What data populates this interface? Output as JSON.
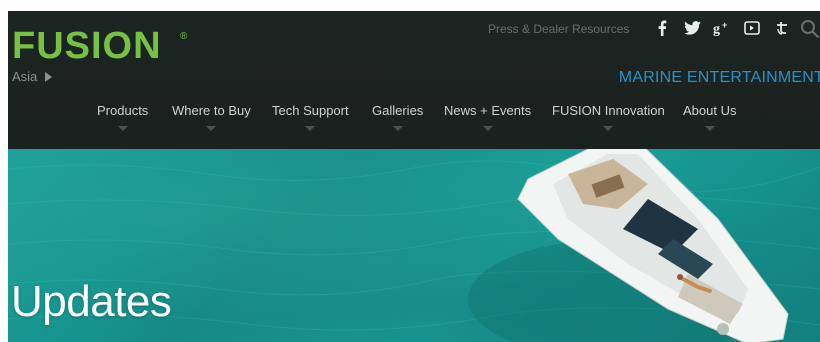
{
  "brand": {
    "name": "FUSION",
    "registered": "®",
    "color": "#76c043"
  },
  "header": {
    "region": "Asia",
    "press_link": "Press & Dealer Resources",
    "tagline": "MARINE ENTERTAINMENT",
    "social_icons": [
      "facebook-icon",
      "twitter-icon",
      "google-plus-icon",
      "youtube-icon",
      "tumblr-icon"
    ]
  },
  "nav": {
    "items": [
      {
        "label": "Products"
      },
      {
        "label": "Where to Buy"
      },
      {
        "label": "Tech Support"
      },
      {
        "label": "Galleries"
      },
      {
        "label": "News + Events"
      },
      {
        "label": "FUSION Innovation"
      },
      {
        "label": "About Us"
      }
    ]
  },
  "hero": {
    "title": "Updates"
  },
  "colors": {
    "header_bg": "#1d2522",
    "accent_blue": "#2d8fc7",
    "nav_text": "#cdd3d0",
    "water": "#1aa39b"
  }
}
